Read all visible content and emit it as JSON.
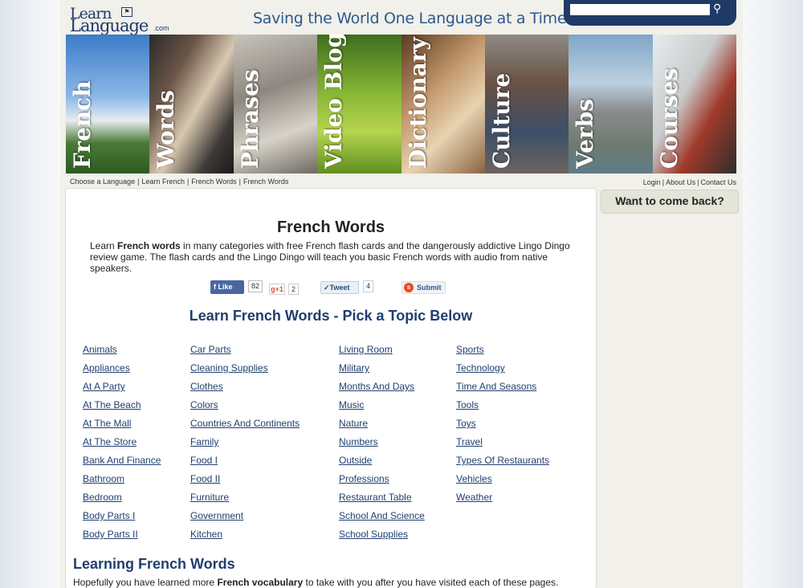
{
  "header": {
    "logo_top": "Learn",
    "logo_bottom": "Language",
    "logo_suffix": ".com",
    "tagline": "Saving the World One Language at a Time",
    "search_placeholder": ""
  },
  "banner": [
    "French",
    "Words",
    "Phrases",
    "Video Blog",
    "Dictionary",
    "Culture",
    "Verbs",
    "Courses"
  ],
  "breadcrumb": [
    "Choose a Language",
    "Learn French",
    "French Words",
    "French Words"
  ],
  "top_links": [
    "Login",
    "About Us",
    "Contact Us"
  ],
  "main": {
    "title": "French Words",
    "intro_before": "Learn ",
    "intro_bold": "French words",
    "intro_after": " in many categories with free French flash cards and the dangerously addictive Lingo Dingo review game. The flash cards and the Lingo Dingo will teach you basic French words with audio from native speakers.",
    "pick_heading": "Learn French Words - Pick a Topic Below",
    "learning_heading": "Learning French Words",
    "outro_before": "Hopefully you have learned more ",
    "outro_bold": "French vocabulary",
    "outro_after": " to take with you after you have visited each of these pages."
  },
  "social": {
    "like_label": "Like",
    "like_count": "82",
    "gplus_label": "g+1",
    "gplus_count": "2",
    "tweet_label": "Tweet",
    "tweet_count": "4",
    "submit_label": "Submit"
  },
  "topics": [
    [
      "Animals",
      "Appliances",
      "At A Party",
      "At The Beach",
      "At The Mall",
      "At The Store",
      "Bank And Finance",
      "Bathroom",
      "Bedroom",
      "Body Parts I",
      "Body Parts II"
    ],
    [
      "Car Parts",
      "Cleaning Supplies",
      "Clothes",
      "Colors",
      "Countries And Continents",
      "Family",
      "Food I",
      "Food II",
      "Furniture",
      "Government",
      "Kitchen"
    ],
    [
      "Living Room",
      "Military",
      "Months And Days",
      "Music",
      "Nature",
      "Numbers",
      "Outside",
      "Professions",
      "Restaurant Table",
      "School And Science",
      "School Supplies"
    ],
    [
      "Sports",
      "Technology",
      "Time And Seasons",
      "Tools",
      "Toys",
      "Travel",
      "Types Of Restaurants",
      "Vehicles",
      "Weather"
    ]
  ],
  "sidebar": {
    "title": "Want to come back?"
  }
}
